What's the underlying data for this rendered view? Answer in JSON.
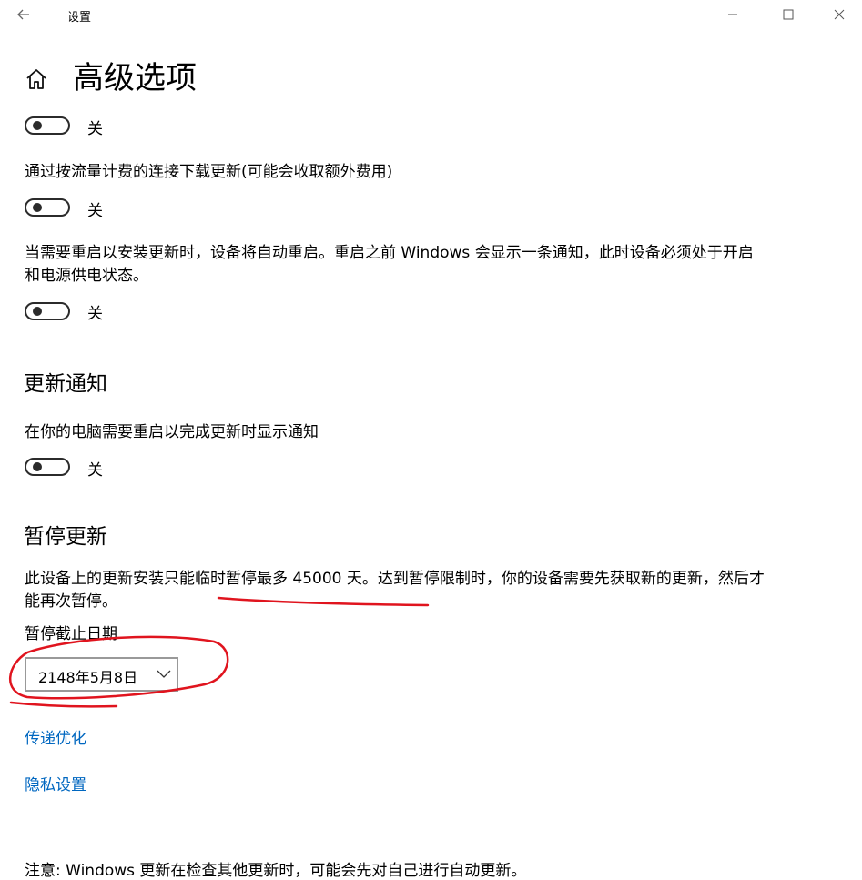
{
  "window": {
    "title": "设置",
    "back_icon": "back-arrow-icon",
    "minimize_icon": "minimize-icon",
    "maximize_icon": "maximize-icon",
    "close_icon": "close-icon"
  },
  "page": {
    "home_icon": "home-icon",
    "title": "高级选项"
  },
  "update_options": {
    "toggle1": {
      "state": "关",
      "on": false
    },
    "metered_label": "通过按流量计费的连接下载更新(可能会收取额外费用)",
    "toggle2": {
      "state": "关",
      "on": false
    },
    "restart_label_line1": "当需要重启以安装更新时，设备将自动重启。重启之前 Windows 会显示一条通知，此时设备必须处于开启",
    "restart_label_line2": "和电源供电状态。",
    "toggle3": {
      "state": "关",
      "on": false
    }
  },
  "update_notifications": {
    "heading": "更新通知",
    "label": "在你的电脑需要重启以完成更新时显示通知",
    "toggle": {
      "state": "关",
      "on": false
    }
  },
  "pause_updates": {
    "heading": "暂停更新",
    "desc_line1": "此设备上的更新安装只能临时暂停最多 45000 天。达到暂停限制时，你的设备需要先获取新的更新，然后才",
    "desc_line2": "能再次暂停。",
    "date_label": "暂停截止日期",
    "date_value": "2148年5月8日",
    "dropdown_icon": "chevron-down-icon"
  },
  "links": {
    "delivery_optimization": "传递优化",
    "privacy_settings": "隐私设置"
  },
  "note": "注意: Windows 更新在检查其他更新时，可能会先对自己进行自动更新。",
  "colors": {
    "link": "#0067c0",
    "annotation": "#e0141e",
    "toggle_off": "#2b2b2b"
  }
}
